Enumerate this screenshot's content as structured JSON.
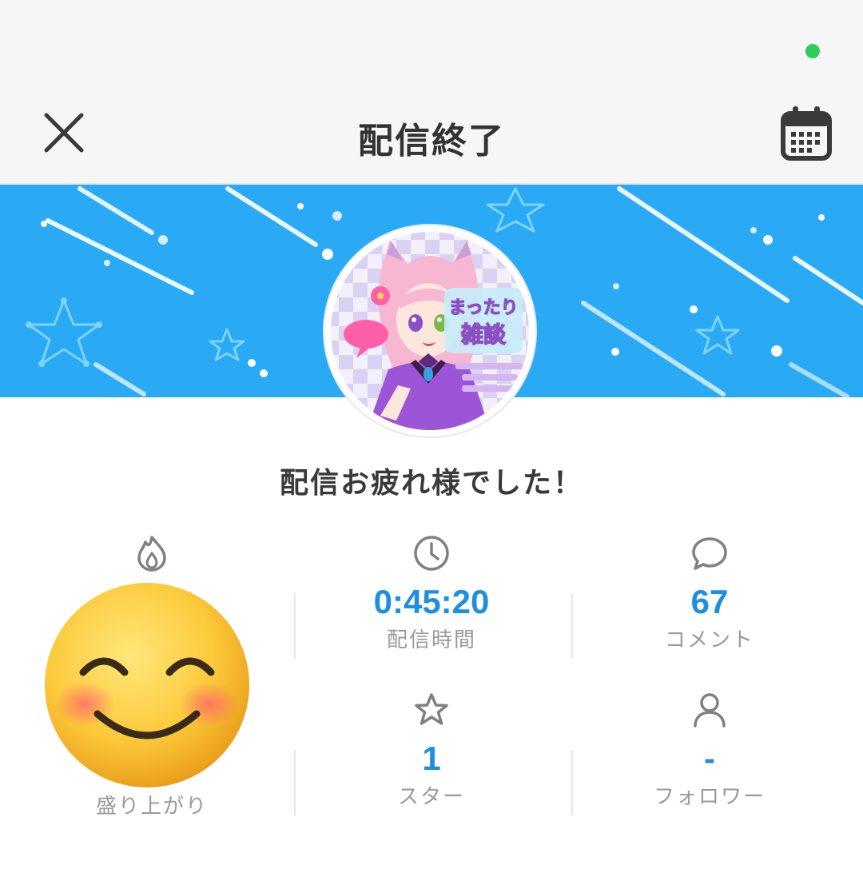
{
  "header": {
    "title": "配信終了"
  },
  "avatar": {
    "badge_line1": "まったり",
    "badge_line2": "雑談"
  },
  "message": "配信お疲れ様でした！",
  "stats": {
    "hype": {
      "label": "盛り上がり",
      "icon": "flame-icon"
    },
    "duration": {
      "value": "0:45:20",
      "label": "配信時間",
      "icon": "clock-icon"
    },
    "comments": {
      "value": "67",
      "label": "コメント",
      "icon": "comment-icon"
    },
    "stars": {
      "value": "1",
      "label": "スター",
      "icon": "star-icon"
    },
    "followers": {
      "value": "-",
      "label": "フォロワー",
      "icon": "person-icon"
    }
  },
  "colors": {
    "accent": "#1d8fe0",
    "banner": "#2aaaf4",
    "status_dot": "#2ecc5a"
  }
}
